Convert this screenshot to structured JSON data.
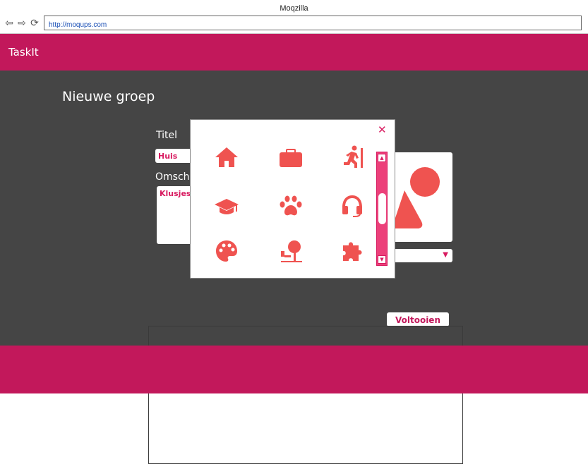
{
  "browser": {
    "title": "Moqzilla",
    "url": "http://moqups.com",
    "back_icon": "arrow-left-icon",
    "forward_icon": "arrow-right-icon",
    "reload_icon": "reload-icon"
  },
  "app": {
    "name": "TaskIt",
    "brand_color": "#c2185b",
    "accent_color": "#ef5350"
  },
  "form": {
    "heading": "Nieuwe groep",
    "title_label": "Titel",
    "title_value": "Huis",
    "description_label": "Omschr",
    "description_value": "Klusjes",
    "image_icon": "image-placeholder-icon",
    "select_arrow": "▼",
    "submit_label": "Voltooien"
  },
  "icon_picker": {
    "close_label": "✕",
    "icons": [
      "home-icon",
      "briefcase-icon",
      "running-person-icon",
      "graduation-cap-icon",
      "paw-icon",
      "headset-icon",
      "palette-icon",
      "park-tree-icon",
      "puzzle-piece-icon"
    ],
    "scroll_up": "▲",
    "scroll_down": "▼"
  }
}
